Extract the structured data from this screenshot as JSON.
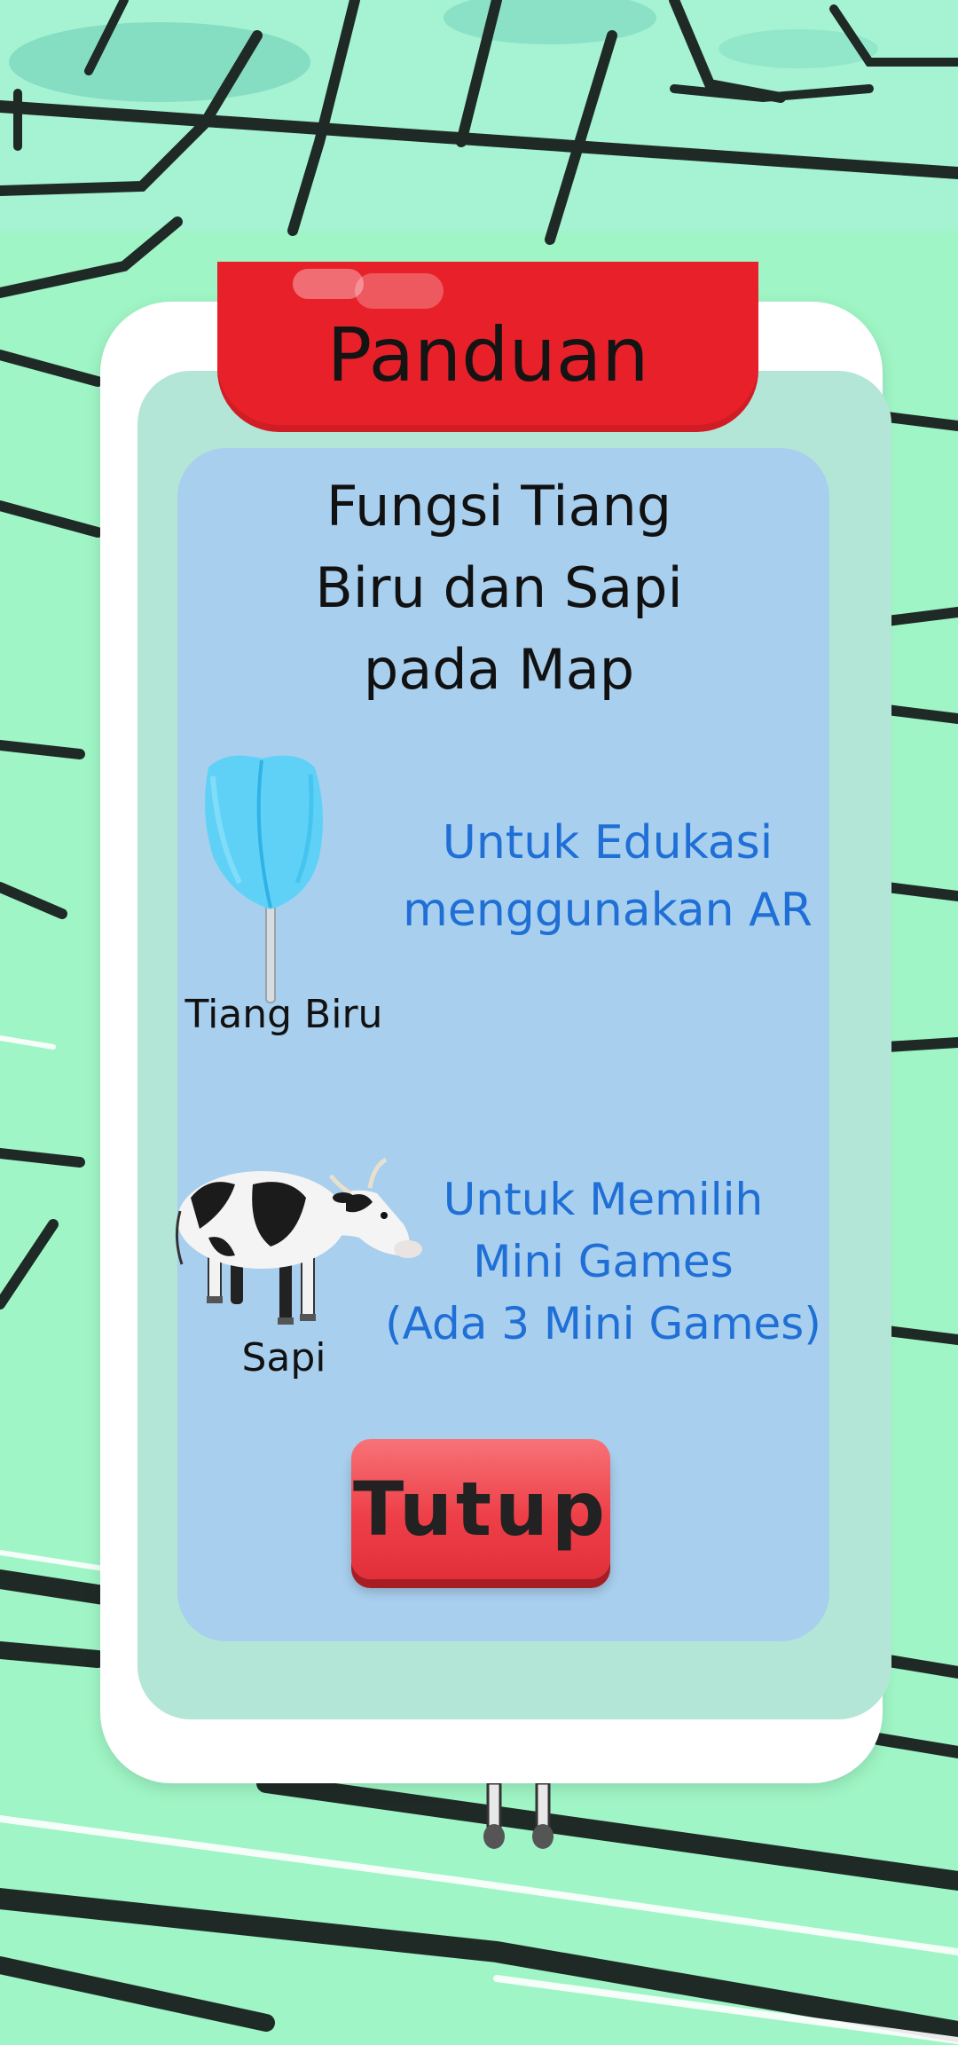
{
  "dialog": {
    "title": "Panduan",
    "subtitle_lines": [
      "Fungsi Tiang",
      "Biru dan Sapi",
      "pada Map"
    ],
    "items": [
      {
        "icon": "blue-pole-icon",
        "label": "Tiang Biru",
        "description_lines": [
          "Untuk Edukasi",
          "menggunakan AR"
        ]
      },
      {
        "icon": "cow-icon",
        "label": "Sapi",
        "description_lines": [
          "Untuk Memilih",
          "Mini Games",
          "(Ada 3 Mini Games)"
        ]
      }
    ],
    "close_label": "Tutup"
  },
  "colors": {
    "map_green": "#9ff5c5",
    "road": "#1f2a27",
    "panel_outer": "#ffffff",
    "panel_mid": "#b3e6d6",
    "panel_inner": "#a8cfee",
    "banner_red": "#e8202a",
    "button_red": "#ee3f48",
    "description_blue": "#1f6fd6"
  }
}
